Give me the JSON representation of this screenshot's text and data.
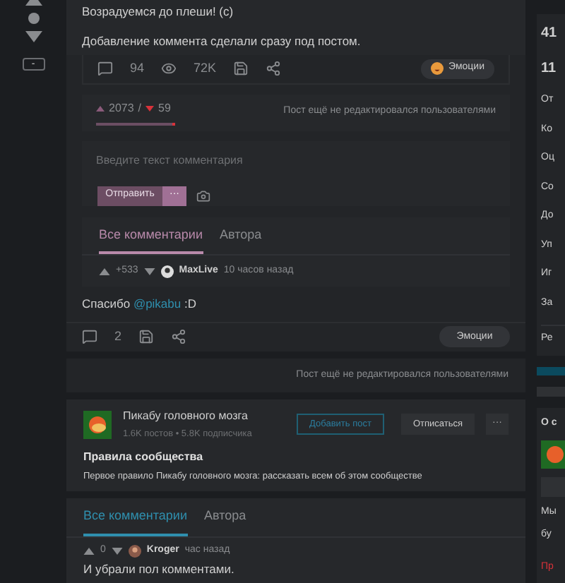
{
  "rail": {
    "collapse_label": "-"
  },
  "post": {
    "paragraphs": [
      "Возрадуемся до плеши! (с)",
      "Добавление коммента сделали сразу под постом."
    ],
    "comments": "94",
    "views": "72K",
    "emotions_label": "Эмоции"
  },
  "rating": {
    "up": "2073",
    "separator": "/",
    "down": "59",
    "level": 0.97,
    "edit_note": "Пост ещё не редактировался пользователями"
  },
  "comment_form": {
    "placeholder": "Введите текст комментария",
    "send_label": "Отправить",
    "more_label": "···"
  },
  "comment_tabs": [
    {
      "label": "Все комментарии",
      "selected": true
    },
    {
      "label": "Автора",
      "selected": false
    }
  ],
  "comment": {
    "score": "+533",
    "author": "MaxLive",
    "time": "10 часов назад"
  },
  "reply": {
    "text_before": "Спасибо",
    "mention": "@pikabu",
    "text_after": ":D",
    "comments": "2",
    "emotions_label": "Эмоции"
  },
  "edit_note": "Пост ещё не редактировался пользователями",
  "community": {
    "name": "Пикабу головного мозга",
    "stats": "1.6K постов • 5.8K подписчика",
    "add_label": "Добавить пост",
    "unsubscribe_label": "Отписаться",
    "more_label": "···",
    "rules_title": "Правила сообщества",
    "rules_text": "Первое правило Пикабу головного мозга: рассказать всем об этом сообществе"
  },
  "comments": {
    "tabs": [
      {
        "label": "Все комментарии",
        "selected": true
      },
      {
        "label": "Автора",
        "selected": false
      }
    ],
    "items": [
      {
        "score": "0",
        "author": "Kroger",
        "time": "час назад",
        "text": "И убрали пол комментами."
      }
    ]
  },
  "sidebar": {
    "stats": [
      "41",
      "11"
    ],
    "menu": [
      "От",
      "Ко",
      "Оц",
      "Со",
      "До",
      "Уп",
      "Иг",
      "За"
    ],
    "edit": "Ре",
    "about": "О с",
    "about_text": [
      "Мы",
      "бу"
    ],
    "report": "Пр"
  }
}
